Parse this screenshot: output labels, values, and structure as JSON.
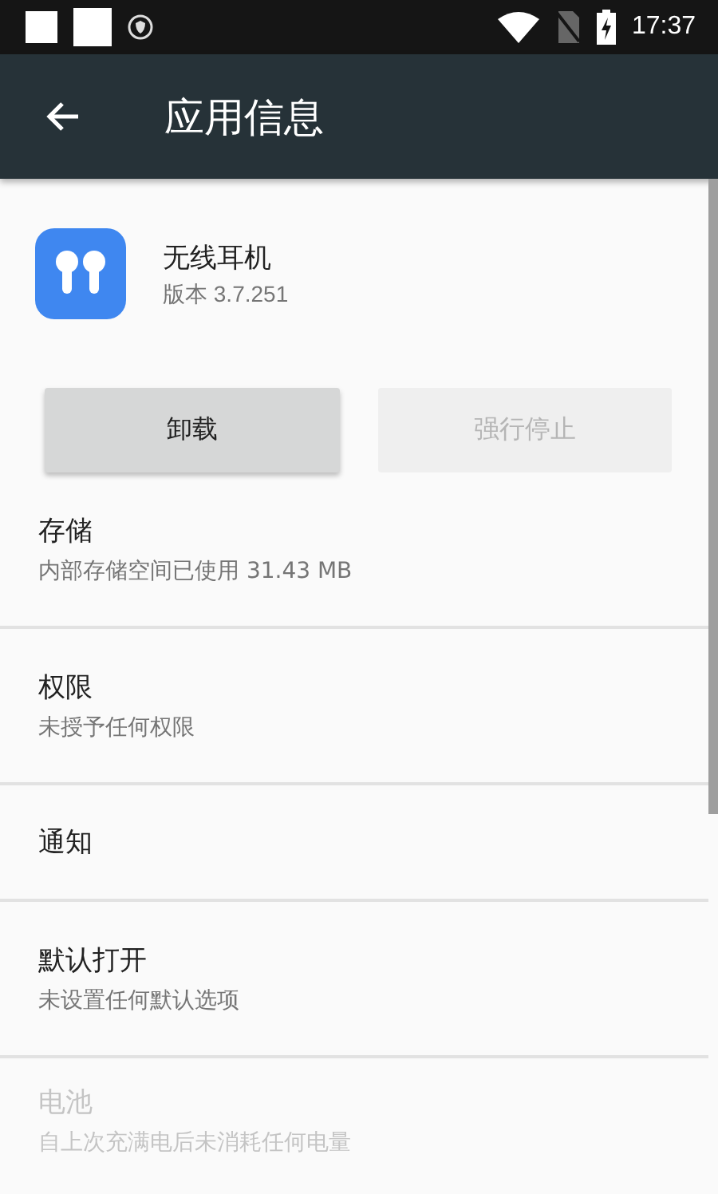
{
  "status_bar": {
    "time": "17:37"
  },
  "app_bar": {
    "title": "应用信息"
  },
  "app": {
    "name": "无线耳机",
    "version": "版本 3.7.251"
  },
  "buttons": [
    {
      "label": "卸载",
      "disabled": false
    },
    {
      "label": "强行停止",
      "disabled": true
    }
  ],
  "settings": [
    {
      "title": "存储",
      "subtitle": "内部存储空间已使用 31.43 MB",
      "disabled": false
    },
    {
      "title": "权限",
      "subtitle": "未授予任何权限",
      "disabled": false
    },
    {
      "title": "通知",
      "disabled": false
    },
    {
      "title": "默认打开",
      "subtitle": "未设置任何默认选项",
      "disabled": false
    },
    {
      "title": "电池",
      "subtitle": "自上次充满电后未消耗任何电量",
      "disabled": true
    }
  ]
}
